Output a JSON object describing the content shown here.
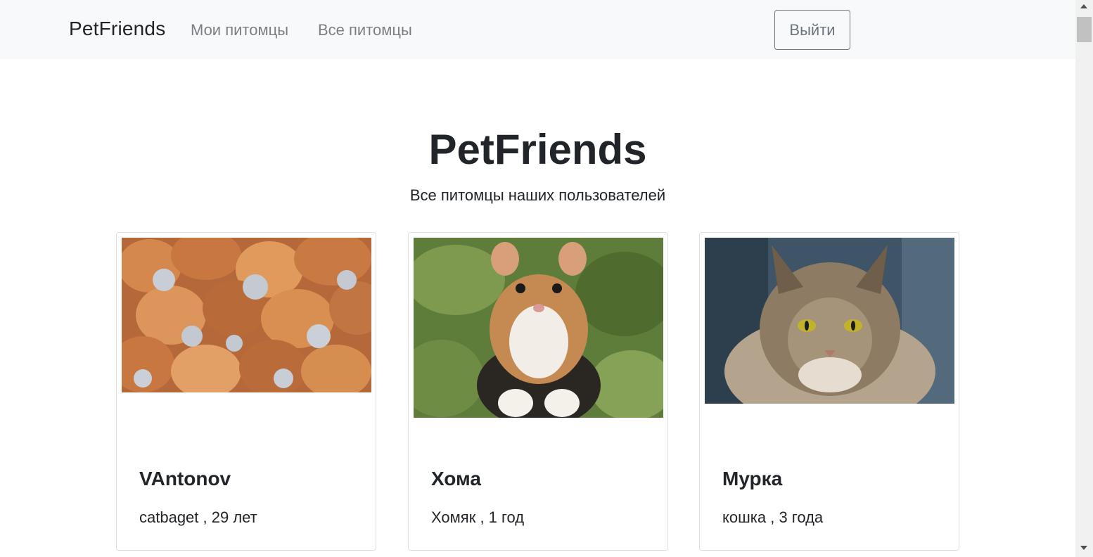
{
  "navbar": {
    "brand": "PetFriends",
    "links": [
      "Мои питомцы",
      "Все питомцы"
    ],
    "logout_label": "Выйти"
  },
  "header": {
    "title": "PetFriends",
    "subtitle": "Все питомцы наших пользователей"
  },
  "pets": [
    {
      "name": "VAntonov",
      "info": "catbaget , 29 лет",
      "photo": "cat-collage-image"
    },
    {
      "name": "Хома",
      "info": "Хомяк , 1 год",
      "photo": "hamster-image"
    },
    {
      "name": "Мурка",
      "info": "кошка , 3 года",
      "photo": "tabby-cat-image"
    }
  ],
  "colors": {
    "navbar_bg": "#f8f9fa",
    "text": "#212529",
    "muted_link": "#7b7f84",
    "outline_button": "#6c757d",
    "card_border": "#dfe0e1"
  }
}
